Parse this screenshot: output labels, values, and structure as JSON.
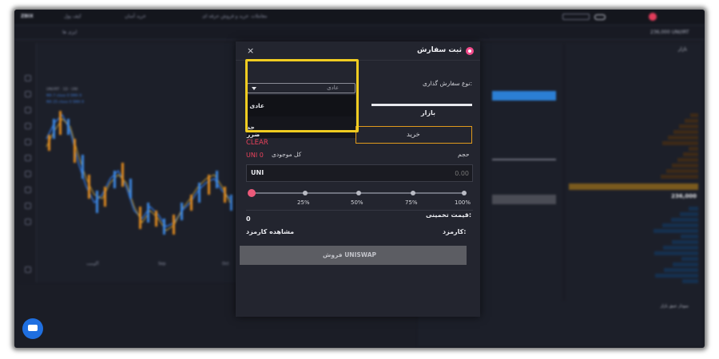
{
  "app": {
    "brand": "ZBIX",
    "nav": [
      "کیف پول",
      "خرید آسان",
      "خرید و فروش حرفه ای",
      "معاملات"
    ],
    "pair_tab": "ایزی ها",
    "price_top": "236,000 UNI/IRT"
  },
  "dialog": {
    "title": "ثبت سفارش",
    "close_glyph": "×",
    "order_type_label": "نوع سفارش گذاری:",
    "order_type_value": "عادی",
    "options": [
      "عادی",
      "حد ضرر"
    ],
    "market_tab": "بازار",
    "buy_label": "خرید",
    "clear_label": "CLEAR",
    "balance_label": "کل موجودی",
    "balance_value": "UNI 0",
    "volume_label": "حجم",
    "currency": "UNI",
    "amount_placeholder": "0.00",
    "slider": {
      "value": 0,
      "ticks": [
        "25%",
        "50%",
        "75%",
        "100%"
      ]
    },
    "estimated_price_label": "قیمت تخمینی:",
    "estimated_price_value": "0",
    "fee_label": "کارمزد:",
    "view_fee_label": "مشاهده کارمزد",
    "sell_button": "فروش UNISWAP"
  },
  "background": {
    "chart_legend": [
      "UNI/IRT · 1D · UNI",
      "MA 7 close 0 SMA 9",
      "MA 25 close 0 SMA 9"
    ],
    "x_labels": [
      "آگوست",
      "Sep",
      "Oct"
    ],
    "orderbook_title": "بازار",
    "orderbook_price": "236,000",
    "depth_title": "نمودار عمق بازار"
  },
  "colors": {
    "accent_highlight": "#f0cc21",
    "buy_border": "#e09a1c",
    "clear": "#e8425b",
    "slider_knob": "#ec5a7a",
    "chat": "#1f6fe0"
  }
}
